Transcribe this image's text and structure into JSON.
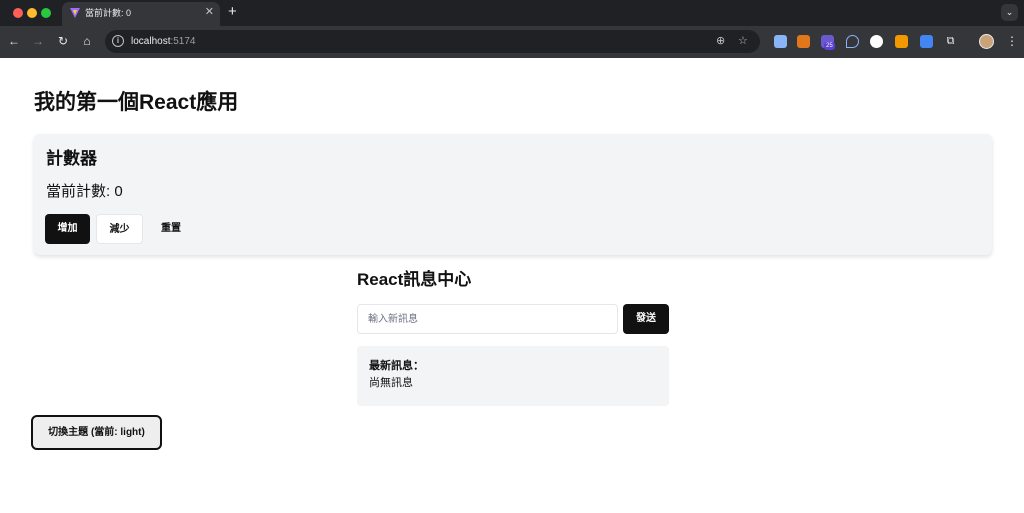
{
  "browser": {
    "tab_title": "當前計數: 0",
    "tab_close": "✕",
    "new_tab": "+",
    "url_host": "localhost",
    "url_port": ":5174",
    "info_icon": "i",
    "extension_badge": "25"
  },
  "app": {
    "title": "我的第一個React應用"
  },
  "counter": {
    "heading": "計數器",
    "count_label": "當前計數:",
    "count_value": "0",
    "increment_label": "增加",
    "decrement_label": "減少",
    "reset_label": "重置"
  },
  "messages": {
    "heading": "React訊息中心",
    "input_placeholder": "輸入新訊息",
    "send_label": "發送",
    "latest_label": "最新訊息：",
    "latest_value": "尚無訊息"
  },
  "theme": {
    "toggle_label": "切換主題 (當前: light)"
  }
}
